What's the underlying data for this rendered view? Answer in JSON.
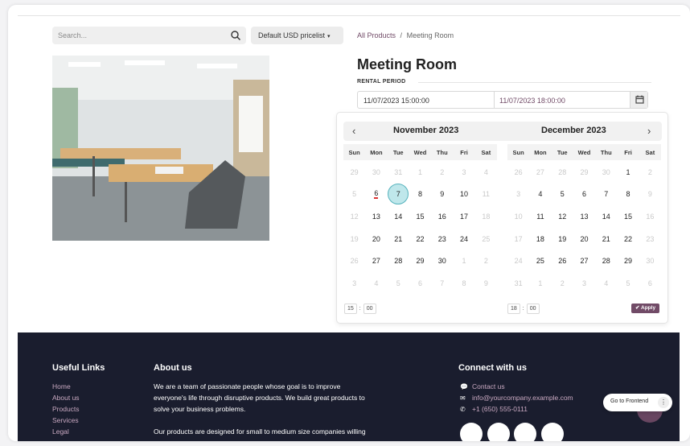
{
  "search": {
    "placeholder": "Search..."
  },
  "pricelist": {
    "label": "Default USD pricelist"
  },
  "breadcrumb": {
    "parent": "All Products",
    "sep": "/",
    "current": "Meeting Room"
  },
  "product": {
    "title": "Meeting Room",
    "rental_label": "RENTAL PERIOD"
  },
  "rental": {
    "start": "11/07/2023 15:00:00",
    "end": "11/07/2023 18:00:00"
  },
  "picker": {
    "prev": "‹",
    "next": "›",
    "weekdays": [
      "Sun",
      "Mon",
      "Tue",
      "Wed",
      "Thu",
      "Fri",
      "Sat"
    ],
    "months": [
      {
        "title": "November 2023",
        "days": [
          [
            "29",
            "m"
          ],
          [
            "30",
            "m"
          ],
          [
            "31",
            "m"
          ],
          [
            "1",
            "m"
          ],
          [
            "2",
            "m"
          ],
          [
            "3",
            "m"
          ],
          [
            "4",
            "m"
          ],
          [
            "5",
            "m"
          ],
          [
            "6",
            "today"
          ],
          [
            "7",
            "sel"
          ],
          [
            "8",
            ""
          ],
          [
            "9",
            ""
          ],
          [
            "10",
            ""
          ],
          [
            "11",
            "m"
          ],
          [
            "12",
            "m"
          ],
          [
            "13",
            ""
          ],
          [
            "14",
            ""
          ],
          [
            "15",
            ""
          ],
          [
            "16",
            ""
          ],
          [
            "17",
            ""
          ],
          [
            "18",
            "m"
          ],
          [
            "19",
            "m"
          ],
          [
            "20",
            ""
          ],
          [
            "21",
            ""
          ],
          [
            "22",
            ""
          ],
          [
            "23",
            ""
          ],
          [
            "24",
            ""
          ],
          [
            "25",
            "m"
          ],
          [
            "26",
            "m"
          ],
          [
            "27",
            ""
          ],
          [
            "28",
            ""
          ],
          [
            "29",
            ""
          ],
          [
            "30",
            ""
          ],
          [
            "1",
            "m"
          ],
          [
            "2",
            "m"
          ],
          [
            "3",
            "m"
          ],
          [
            "4",
            "m"
          ],
          [
            "5",
            "m"
          ],
          [
            "6",
            "m"
          ],
          [
            "7",
            "m"
          ],
          [
            "8",
            "m"
          ],
          [
            "9",
            "m"
          ]
        ],
        "time": {
          "hour": "15",
          "min": "00"
        }
      },
      {
        "title": "December 2023",
        "days": [
          [
            "26",
            "m"
          ],
          [
            "27",
            "m"
          ],
          [
            "28",
            "m"
          ],
          [
            "29",
            "m"
          ],
          [
            "30",
            "m"
          ],
          [
            "1",
            ""
          ],
          [
            "2",
            "m"
          ],
          [
            "3",
            "m"
          ],
          [
            "4",
            ""
          ],
          [
            "5",
            ""
          ],
          [
            "6",
            ""
          ],
          [
            "7",
            ""
          ],
          [
            "8",
            ""
          ],
          [
            "9",
            "m"
          ],
          [
            "10",
            "m"
          ],
          [
            "11",
            ""
          ],
          [
            "12",
            ""
          ],
          [
            "13",
            ""
          ],
          [
            "14",
            ""
          ],
          [
            "15",
            ""
          ],
          [
            "16",
            "m"
          ],
          [
            "17",
            "m"
          ],
          [
            "18",
            ""
          ],
          [
            "19",
            ""
          ],
          [
            "20",
            ""
          ],
          [
            "21",
            ""
          ],
          [
            "22",
            ""
          ],
          [
            "23",
            "m"
          ],
          [
            "24",
            "m"
          ],
          [
            "25",
            ""
          ],
          [
            "26",
            ""
          ],
          [
            "27",
            ""
          ],
          [
            "28",
            ""
          ],
          [
            "29",
            ""
          ],
          [
            "30",
            "m"
          ],
          [
            "31",
            "m"
          ],
          [
            "1",
            "m"
          ],
          [
            "2",
            "m"
          ],
          [
            "3",
            "m"
          ],
          [
            "4",
            "m"
          ],
          [
            "5",
            "m"
          ],
          [
            "6",
            "m"
          ]
        ],
        "time": {
          "hour": "18",
          "min": "00"
        }
      }
    ],
    "apply": "✔ Apply"
  },
  "footer": {
    "useful_links": {
      "title": "Useful Links",
      "items": [
        "Home",
        "About us",
        "Products",
        "Services",
        "Legal"
      ]
    },
    "about": {
      "title": "About us",
      "p1a": "We are a team of passionate people whose goal is to improve",
      "p1b": "everyone's life through disruptive products. We build great products to",
      "p1c": "solve your business problems.",
      "p2": "Our products are designed for small to medium size companies willing"
    },
    "connect": {
      "title": "Connect with us",
      "contact": "Contact us",
      "email": "info@yourcompany.example.com",
      "phone": "+1 (650) 555-0111"
    }
  },
  "go_frontend": "Go to Frontend",
  "colors": {
    "accent": "#714b67",
    "footer_bg": "#1a1d2e",
    "selected_day": "#bfe7eb"
  }
}
